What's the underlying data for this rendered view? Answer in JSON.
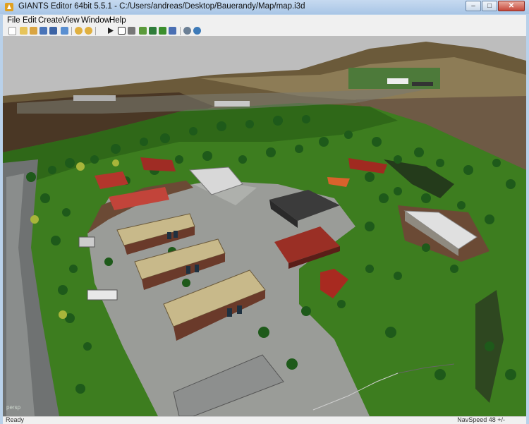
{
  "window": {
    "title": "GIANTS Editor 64bit 5.5.1 - C:/Users/andreas/Desktop/Bauerandy/Map/map.i3d",
    "controls": [
      "minimize-icon",
      "maximize-icon",
      "close-icon"
    ]
  },
  "menu": {
    "items": [
      "File",
      "Edit",
      "Create",
      "View",
      "Window",
      "Help"
    ]
  },
  "toolbar": {
    "buttons": [
      "new-icon",
      "open-icon",
      "edit-icon",
      "save-icon",
      "save-as-icon",
      "import-icon",
      "undo-icon",
      "redo-icon",
      "play-icon",
      "select-icon",
      "move-icon",
      "terrain-icon",
      "paint-icon",
      "foliage-icon",
      "cut-icon",
      "settings-icon",
      "globe-icon"
    ]
  },
  "viewport": {
    "camera_label": "persp",
    "colors": {
      "sky": "#bdbdbd",
      "grass": "#3d7d1f",
      "concrete": "#9a9c98",
      "roof_red": "#b3362c",
      "roof_tin": "#c8b98a"
    }
  },
  "status": {
    "left": "Ready",
    "right": "NavSpeed 48 +/-"
  }
}
